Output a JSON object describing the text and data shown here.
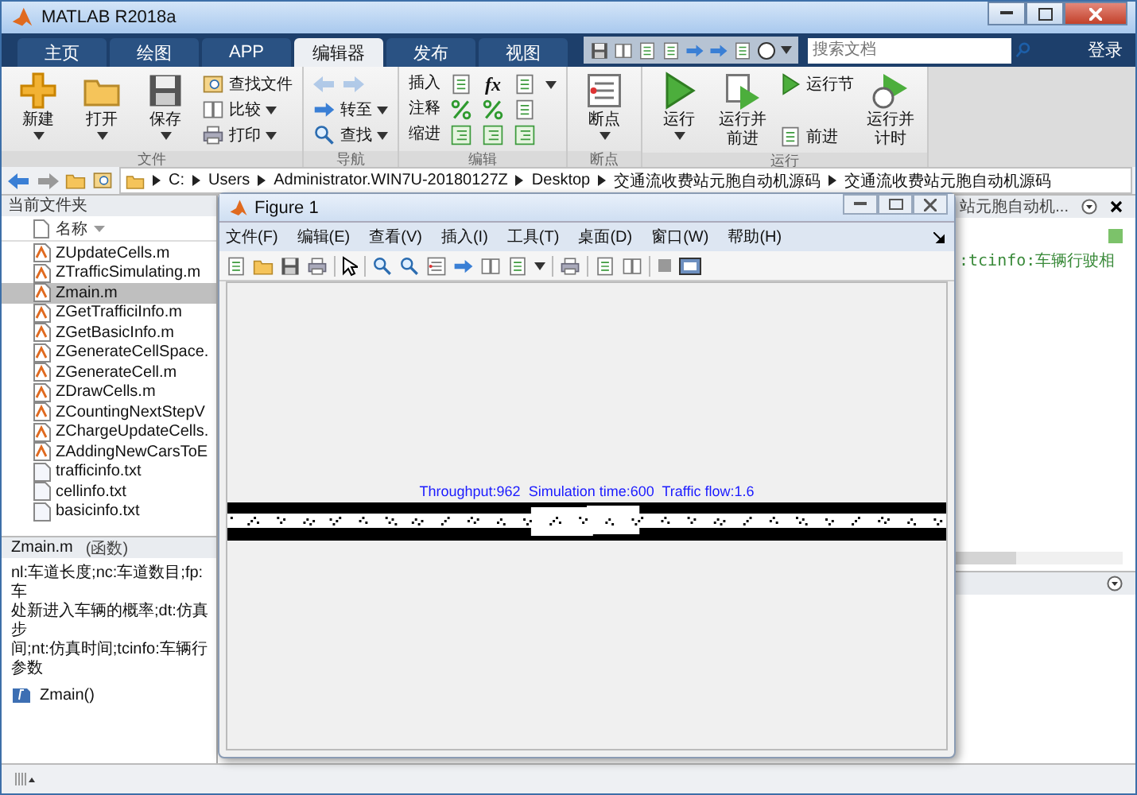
{
  "window": {
    "title": "MATLAB R2018a"
  },
  "tabs": [
    {
      "label": "主页",
      "selected": false
    },
    {
      "label": "绘图",
      "selected": false
    },
    {
      "label": "APP",
      "selected": false
    },
    {
      "label": "编辑器",
      "selected": true
    },
    {
      "label": "发布",
      "selected": false
    },
    {
      "label": "视图",
      "selected": false
    }
  ],
  "search": {
    "placeholder": "搜索文档"
  },
  "sign_in": "登录",
  "ribbon": {
    "groups": [
      {
        "title": "文件",
        "columns": [
          [
            {
              "kind": "large",
              "label": "新建",
              "dropdown": true
            }
          ],
          [
            {
              "kind": "large",
              "label": "打开",
              "dropdown": true
            }
          ],
          [
            {
              "kind": "large",
              "label": "保存",
              "dropdown": true
            }
          ],
          [
            {
              "kind": "small",
              "label": "查找文件",
              "dropdown": false
            },
            {
              "kind": "small",
              "label": "比较",
              "dropdown": true
            },
            {
              "kind": "small",
              "label": "打印",
              "dropdown": true
            }
          ]
        ]
      },
      {
        "title": "导航",
        "columns": [
          [
            {
              "kind": "arrows",
              "disabled": true
            },
            {
              "kind": "small",
              "label": "转至",
              "dropdown": true
            },
            {
              "kind": "small",
              "label": "查找",
              "dropdown": true
            }
          ]
        ]
      },
      {
        "title": "编辑",
        "columns": [
          [
            {
              "kind": "text",
              "label": "插入"
            },
            {
              "kind": "text",
              "label": "注释"
            },
            {
              "kind": "text",
              "label": "缩进"
            }
          ],
          [
            {
              "kind": "icon",
              "dropdown": false
            },
            {
              "kind": "icon",
              "dropdown": false
            },
            {
              "kind": "icon",
              "dropdown": false
            }
          ],
          [
            {
              "kind": "glyph",
              "label": "fx"
            },
            {
              "kind": "icon",
              "dropdown": false
            },
            {
              "kind": "icon",
              "dropdown": false
            }
          ],
          [
            {
              "kind": "icon",
              "dropdown": true
            },
            {
              "kind": "icon",
              "dropdown": false
            },
            {
              "kind": "icon",
              "dropdown": false
            }
          ]
        ]
      },
      {
        "title": "断点",
        "columns": [
          [
            {
              "kind": "large",
              "label": "断点",
              "dropdown": true
            }
          ]
        ]
      },
      {
        "title": "运行",
        "columns": [
          [
            {
              "kind": "large",
              "label": "运行",
              "dropdown": true
            }
          ],
          [
            {
              "kind": "large",
              "label": "运行并前进",
              "dropdown": false
            }
          ],
          [
            {
              "kind": "small",
              "label": "运行节",
              "dropdown": false
            },
            {
              "kind": "small",
              "label": "前进",
              "dropdown": false
            }
          ],
          [
            {
              "kind": "large",
              "label": "运行并计时",
              "dropdown": false
            }
          ]
        ]
      }
    ]
  },
  "address": {
    "path": [
      "C:",
      "Users",
      "Administrator.WIN7U-20180127Z",
      "Desktop",
      "交通流收费站元胞自动机源码",
      "交通流收费站元胞自动机源码"
    ]
  },
  "file_panel": {
    "title": "当前文件夹",
    "column": "名称",
    "files": [
      {
        "name": "ZUpdateCells.m",
        "kind": "m",
        "selected": false
      },
      {
        "name": "ZTrafficSimulating.m",
        "kind": "m",
        "selected": false
      },
      {
        "name": "Zmain.m",
        "kind": "m",
        "selected": true
      },
      {
        "name": "ZGetTrafficiInfo.m",
        "kind": "m",
        "selected": false
      },
      {
        "name": "ZGetBasicInfo.m",
        "kind": "m",
        "selected": false
      },
      {
        "name": "ZGenerateCellSpace.",
        "kind": "m",
        "selected": false
      },
      {
        "name": "ZGenerateCell.m",
        "kind": "m",
        "selected": false
      },
      {
        "name": "ZDrawCells.m",
        "kind": "m",
        "selected": false
      },
      {
        "name": "ZCountingNextStepV",
        "kind": "m",
        "selected": false
      },
      {
        "name": "ZChargeUpdateCells.",
        "kind": "m",
        "selected": false
      },
      {
        "name": "ZAddingNewCarsToE",
        "kind": "m",
        "selected": false
      },
      {
        "name": "trafficinfo.txt",
        "kind": "txt",
        "selected": false
      },
      {
        "name": "cellinfo.txt",
        "kind": "txt",
        "selected": false
      },
      {
        "name": "basicinfo.txt",
        "kind": "txt",
        "selected": false
      }
    ]
  },
  "details": {
    "file": "Zmain.m",
    "type": "(函数)",
    "lines": [
      "nl:车道长度;nc:车道数目;fp:车",
      "处新进入车辆的概率;dt:仿真步",
      "间;nt:仿真时间;tcinfo:车辆行",
      "参数"
    ],
    "function": "Zmain()"
  },
  "editor": {
    "tab": "站元胞自动机...",
    "code_line": ":tcinfo:车辆行驶相"
  },
  "figure": {
    "title": "Figure 1",
    "menu": [
      "文件(F)",
      "编辑(E)",
      "查看(V)",
      "插入(I)",
      "工具(T)",
      "桌面(D)",
      "窗口(W)",
      "帮助(H)"
    ],
    "plot_title": "Throughput:962  Simulation time:600  Traffic flow:1.6"
  }
}
